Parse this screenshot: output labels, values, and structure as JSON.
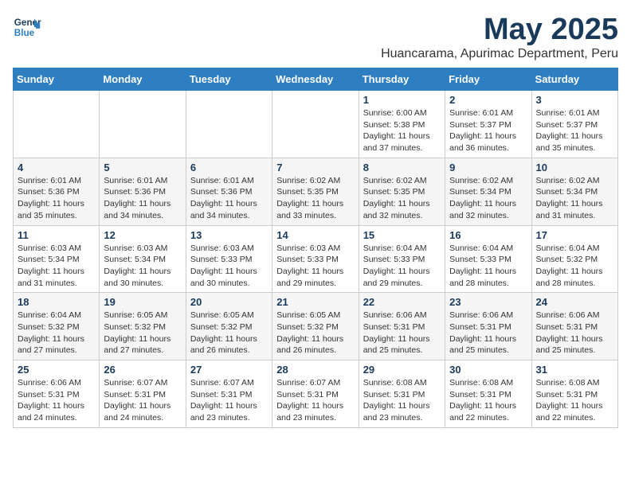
{
  "header": {
    "logo_line1": "General",
    "logo_line2": "Blue",
    "month": "May 2025",
    "location": "Huancarama, Apurimac Department, Peru"
  },
  "weekdays": [
    "Sunday",
    "Monday",
    "Tuesday",
    "Wednesday",
    "Thursday",
    "Friday",
    "Saturday"
  ],
  "weeks": [
    [
      {
        "day": "",
        "info": ""
      },
      {
        "day": "",
        "info": ""
      },
      {
        "day": "",
        "info": ""
      },
      {
        "day": "",
        "info": ""
      },
      {
        "day": "1",
        "info": "Sunrise: 6:00 AM\nSunset: 5:38 PM\nDaylight: 11 hours\nand 37 minutes."
      },
      {
        "day": "2",
        "info": "Sunrise: 6:01 AM\nSunset: 5:37 PM\nDaylight: 11 hours\nand 36 minutes."
      },
      {
        "day": "3",
        "info": "Sunrise: 6:01 AM\nSunset: 5:37 PM\nDaylight: 11 hours\nand 35 minutes."
      }
    ],
    [
      {
        "day": "4",
        "info": "Sunrise: 6:01 AM\nSunset: 5:36 PM\nDaylight: 11 hours\nand 35 minutes."
      },
      {
        "day": "5",
        "info": "Sunrise: 6:01 AM\nSunset: 5:36 PM\nDaylight: 11 hours\nand 34 minutes."
      },
      {
        "day": "6",
        "info": "Sunrise: 6:01 AM\nSunset: 5:36 PM\nDaylight: 11 hours\nand 34 minutes."
      },
      {
        "day": "7",
        "info": "Sunrise: 6:02 AM\nSunset: 5:35 PM\nDaylight: 11 hours\nand 33 minutes."
      },
      {
        "day": "8",
        "info": "Sunrise: 6:02 AM\nSunset: 5:35 PM\nDaylight: 11 hours\nand 32 minutes."
      },
      {
        "day": "9",
        "info": "Sunrise: 6:02 AM\nSunset: 5:34 PM\nDaylight: 11 hours\nand 32 minutes."
      },
      {
        "day": "10",
        "info": "Sunrise: 6:02 AM\nSunset: 5:34 PM\nDaylight: 11 hours\nand 31 minutes."
      }
    ],
    [
      {
        "day": "11",
        "info": "Sunrise: 6:03 AM\nSunset: 5:34 PM\nDaylight: 11 hours\nand 31 minutes."
      },
      {
        "day": "12",
        "info": "Sunrise: 6:03 AM\nSunset: 5:34 PM\nDaylight: 11 hours\nand 30 minutes."
      },
      {
        "day": "13",
        "info": "Sunrise: 6:03 AM\nSunset: 5:33 PM\nDaylight: 11 hours\nand 30 minutes."
      },
      {
        "day": "14",
        "info": "Sunrise: 6:03 AM\nSunset: 5:33 PM\nDaylight: 11 hours\nand 29 minutes."
      },
      {
        "day": "15",
        "info": "Sunrise: 6:04 AM\nSunset: 5:33 PM\nDaylight: 11 hours\nand 29 minutes."
      },
      {
        "day": "16",
        "info": "Sunrise: 6:04 AM\nSunset: 5:33 PM\nDaylight: 11 hours\nand 28 minutes."
      },
      {
        "day": "17",
        "info": "Sunrise: 6:04 AM\nSunset: 5:32 PM\nDaylight: 11 hours\nand 28 minutes."
      }
    ],
    [
      {
        "day": "18",
        "info": "Sunrise: 6:04 AM\nSunset: 5:32 PM\nDaylight: 11 hours\nand 27 minutes."
      },
      {
        "day": "19",
        "info": "Sunrise: 6:05 AM\nSunset: 5:32 PM\nDaylight: 11 hours\nand 27 minutes."
      },
      {
        "day": "20",
        "info": "Sunrise: 6:05 AM\nSunset: 5:32 PM\nDaylight: 11 hours\nand 26 minutes."
      },
      {
        "day": "21",
        "info": "Sunrise: 6:05 AM\nSunset: 5:32 PM\nDaylight: 11 hours\nand 26 minutes."
      },
      {
        "day": "22",
        "info": "Sunrise: 6:06 AM\nSunset: 5:31 PM\nDaylight: 11 hours\nand 25 minutes."
      },
      {
        "day": "23",
        "info": "Sunrise: 6:06 AM\nSunset: 5:31 PM\nDaylight: 11 hours\nand 25 minutes."
      },
      {
        "day": "24",
        "info": "Sunrise: 6:06 AM\nSunset: 5:31 PM\nDaylight: 11 hours\nand 25 minutes."
      }
    ],
    [
      {
        "day": "25",
        "info": "Sunrise: 6:06 AM\nSunset: 5:31 PM\nDaylight: 11 hours\nand 24 minutes."
      },
      {
        "day": "26",
        "info": "Sunrise: 6:07 AM\nSunset: 5:31 PM\nDaylight: 11 hours\nand 24 minutes."
      },
      {
        "day": "27",
        "info": "Sunrise: 6:07 AM\nSunset: 5:31 PM\nDaylight: 11 hours\nand 23 minutes."
      },
      {
        "day": "28",
        "info": "Sunrise: 6:07 AM\nSunset: 5:31 PM\nDaylight: 11 hours\nand 23 minutes."
      },
      {
        "day": "29",
        "info": "Sunrise: 6:08 AM\nSunset: 5:31 PM\nDaylight: 11 hours\nand 23 minutes."
      },
      {
        "day": "30",
        "info": "Sunrise: 6:08 AM\nSunset: 5:31 PM\nDaylight: 11 hours\nand 22 minutes."
      },
      {
        "day": "31",
        "info": "Sunrise: 6:08 AM\nSunset: 5:31 PM\nDaylight: 11 hours\nand 22 minutes."
      }
    ]
  ]
}
